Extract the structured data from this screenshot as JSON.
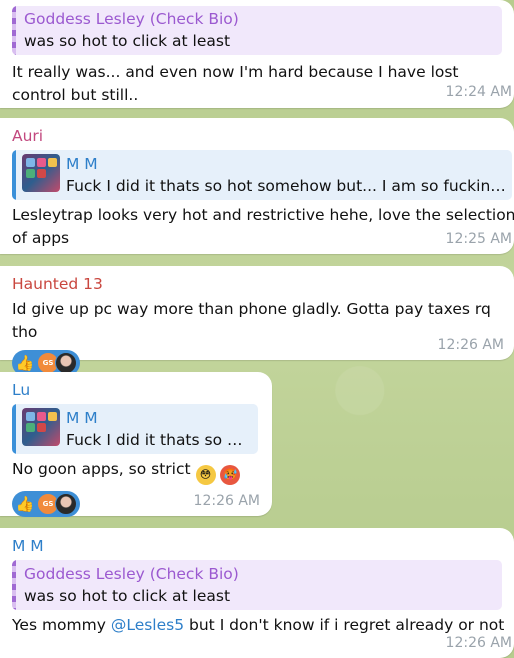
{
  "messages": [
    {
      "reply": {
        "name": "Goddess Lesley (Check Bio)",
        "text": "was so hot to click at least"
      },
      "text": "It really was... and even now I'm hard because I have lost control but still..",
      "time": "12:24 AM"
    },
    {
      "sender": "Auri",
      "sender_color": "#c2487e",
      "reply": {
        "name": "M M",
        "text": "Fuck I did it thats so hot somehow but... I  am so fucking ..."
      },
      "text": "Lesleytrap looks very hot and restrictive hehe, love the selection of apps",
      "time": "12:25 AM"
    },
    {
      "sender": "Haunted 13",
      "sender_color": "#c9473f",
      "text": "Id give up pc way more than phone gladly. Gotta pay taxes rq tho",
      "reaction_avatar": "GS",
      "time": "12:26 AM"
    },
    {
      "sender": "Lu",
      "sender_color": "#2e7fc9",
      "reply": {
        "name": "M M",
        "text": "Fuck I did it thats so h..."
      },
      "text": "No goon apps, so strict",
      "reaction_avatar": "GS",
      "time": "12:26 AM"
    },
    {
      "sender": "M M",
      "sender_color": "#2e7fc9",
      "reply": {
        "name": "Goddess Lesley (Check Bio)",
        "text": "was so hot to click at least"
      },
      "text_before": "Yes mommy ",
      "mention": "@Lesles5",
      "text_after": " but I don't know if i regret already or not",
      "time": "12:26 AM"
    }
  ],
  "colors": {
    "reply_purple": "#9b59d0",
    "reply_blue": "#2e7fc9",
    "reaction_blue": "#3e8fd6",
    "time_gray": "#9aa3ab"
  },
  "icons": {
    "reaction": "thumbs-up-icon",
    "emojis": [
      "flushed-face-icon",
      "hot-face-icon"
    ]
  }
}
